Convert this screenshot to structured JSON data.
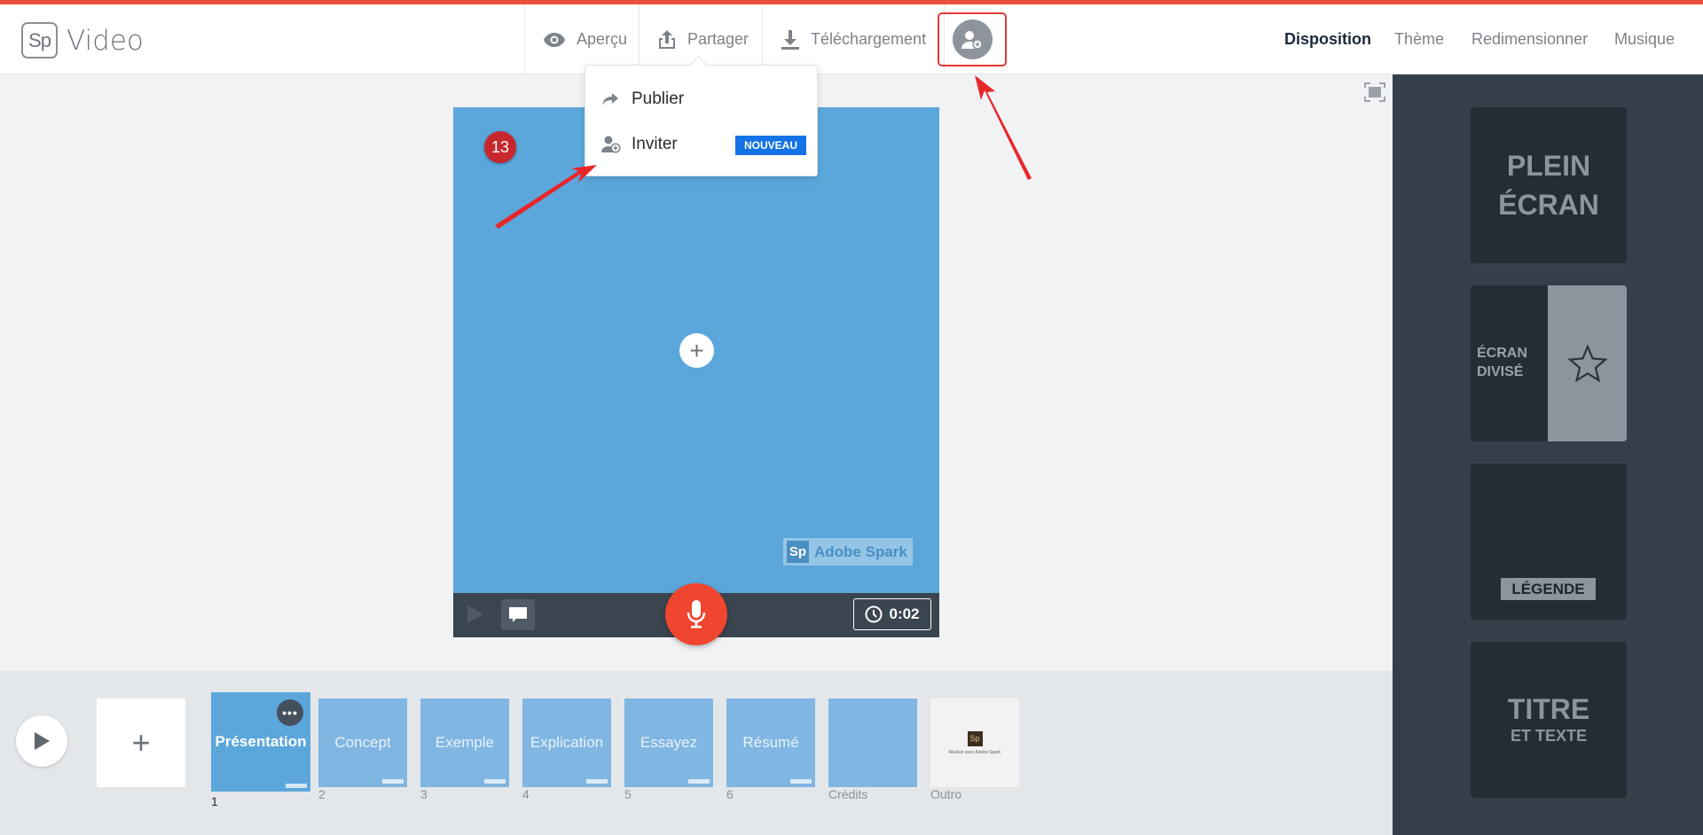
{
  "app": {
    "logo_letters": "Sp",
    "name": "Video"
  },
  "header": {
    "preview_label": "Aperçu",
    "share_label": "Partager",
    "download_label": "Téléchargement",
    "invite_icon": "person-plus-icon"
  },
  "right_nav": {
    "layout": "Disposition",
    "theme": "Thème",
    "resize": "Redimensionner",
    "music": "Musique"
  },
  "share_menu": {
    "publish": "Publier",
    "invite": "Inviter",
    "new_badge": "NOUVEAU"
  },
  "stage": {
    "slide_number": "13",
    "watermark_sp": "Sp",
    "watermark_text": "Adobe Spark",
    "background": "#5ba7db",
    "duration": "0:02"
  },
  "layouts": {
    "full_1": "PLEIN",
    "full_2": "ÉCRAN",
    "split_1": "ÉCRAN",
    "split_2": "DIVISÉ",
    "caption": "LÉGENDE",
    "title_1": "TITRE",
    "title_2": "ET TEXTE"
  },
  "timeline": {
    "slides": [
      {
        "title": "Présentation",
        "label": "1"
      },
      {
        "title": "Concept",
        "label": "2"
      },
      {
        "title": "Exemple",
        "label": "3"
      },
      {
        "title": "Explication",
        "label": "4"
      },
      {
        "title": "Essayez",
        "label": "5"
      },
      {
        "title": "Résumé",
        "label": "6"
      },
      {
        "title": "",
        "label": "Crédits"
      },
      {
        "title": "",
        "label": "Outro"
      }
    ],
    "outro_sp": "Sp",
    "outro_text": "Réalisé avec Adobe Spark"
  },
  "colors": {
    "accent": "#e8503a",
    "badge": "#1473e6",
    "mic": "#f0452f",
    "annotation": "#e53935"
  }
}
